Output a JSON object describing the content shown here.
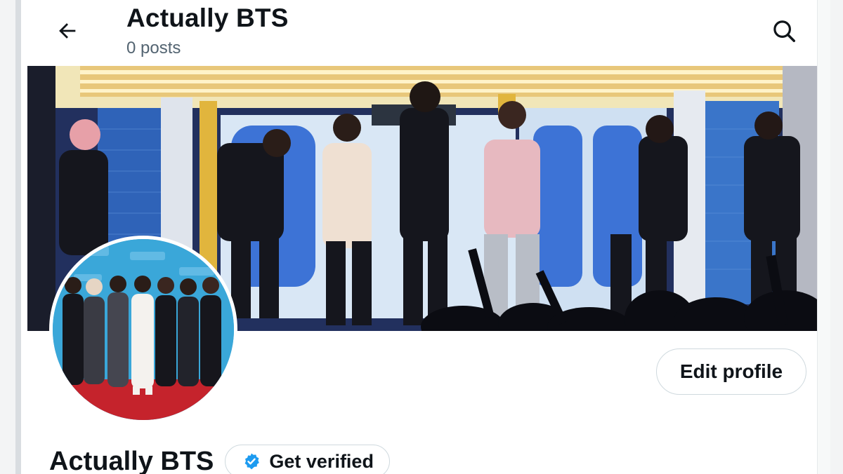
{
  "header": {
    "title": "Actually BTS",
    "subtitle": "0 posts",
    "back_icon": "arrow-left-icon",
    "search_icon": "search-icon"
  },
  "banner": {
    "description_icon": "concert-stage-photo"
  },
  "avatar": {
    "icon": "group-photo-avatar"
  },
  "actions": {
    "edit_profile_label": "Edit profile"
  },
  "profile": {
    "name": "Actually BTS",
    "get_verified_label": "Get verified",
    "verified_badge_color": "#1d9bf0"
  },
  "colors": {
    "text_primary": "#0f1419",
    "text_secondary": "#536471",
    "border": "#cfd9de",
    "accent": "#1d9bf0"
  }
}
